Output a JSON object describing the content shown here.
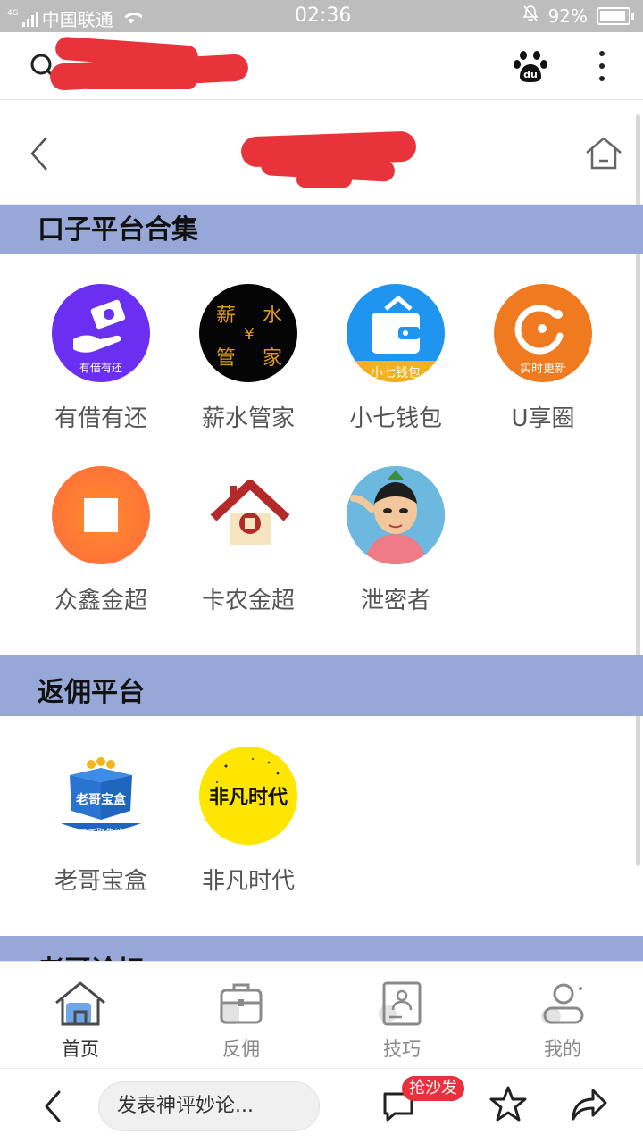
{
  "status_bar": {
    "network": "4G",
    "carrier": "中国联通",
    "time": "02:36",
    "battery": "92%"
  },
  "sections": [
    {
      "title": "口子平台合集",
      "apps": [
        {
          "label": "有借有还",
          "icon": "有借有还",
          "icon_name": "hand-money-icon"
        },
        {
          "label": "薪水管家",
          "icon": "薪水管家",
          "icon_name": "salary-housekeeper-icon"
        },
        {
          "label": "小七钱包",
          "icon": "小七钱包",
          "icon_name": "wallet-icon"
        },
        {
          "label": "U享圈",
          "icon": "实时更新",
          "icon_name": "u-circle-icon"
        },
        {
          "label": "众鑫金超",
          "icon": "",
          "icon_name": "square-coin-icon"
        },
        {
          "label": "卡农金超",
          "icon": "",
          "icon_name": "house-icon"
        },
        {
          "label": "泄密者",
          "icon": "",
          "icon_name": "cartoon-character-icon"
        }
      ]
    },
    {
      "title": "返佣平台",
      "apps": [
        {
          "label": "老哥宝盒",
          "icon": "口子聚集地",
          "icon_name": "treasure-box-icon"
        },
        {
          "label": "非凡时代",
          "icon": "非凡时代",
          "icon_name": "extraordinary-times-icon"
        }
      ]
    },
    {
      "title": "老哥论坛"
    }
  ],
  "tabs": [
    {
      "label": "首页",
      "icon": "home-icon",
      "active": true
    },
    {
      "label": "反佣",
      "icon": "briefcase-icon",
      "active": false
    },
    {
      "label": "技巧",
      "icon": "document-icon",
      "active": false
    },
    {
      "label": "我的",
      "icon": "person-icon",
      "active": false
    }
  ],
  "comment_bar": {
    "placeholder": "发表神评妙论...",
    "badge": "抢沙发"
  },
  "colors": {
    "section_bar": "#97a8d8",
    "tab_accent": "#6fa6e8",
    "badge": "#e9303c",
    "redaction": "#e8333a"
  }
}
